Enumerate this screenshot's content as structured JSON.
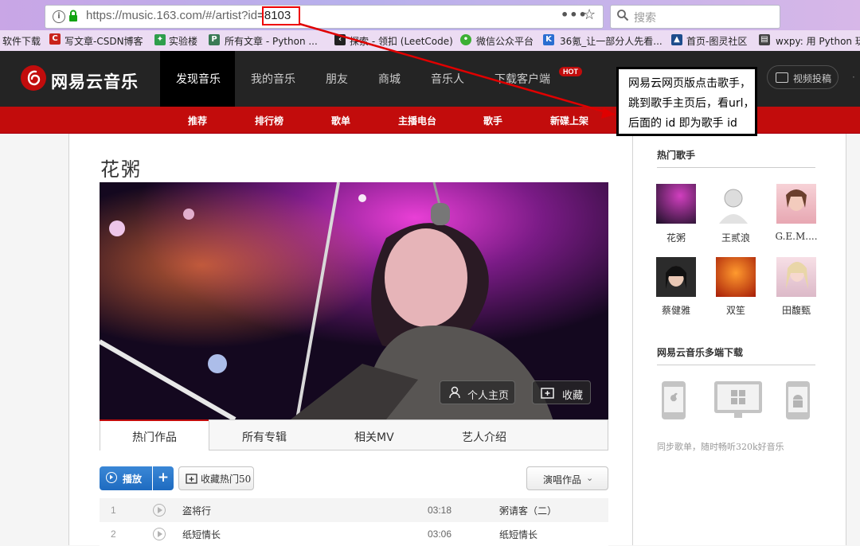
{
  "browser": {
    "url_prefix": "https://music.163.com/#/artist?id",
    "url_id": "=8103",
    "search_placeholder": "搜索",
    "more_label": "•••",
    "bookmarks": [
      {
        "label": "软件下载"
      },
      {
        "label": "写文章-CSDN博客"
      },
      {
        "label": "实验楼"
      },
      {
        "label": "所有文章 - Python ..."
      },
      {
        "label": "探索 - 领扣 (LeetCode)"
      },
      {
        "label": "微信公众平台"
      },
      {
        "label": "36氪_让一部分人先看..."
      },
      {
        "label": "首页-图灵社区"
      },
      {
        "label": "wxpy: 用 Python 玩"
      }
    ]
  },
  "site": {
    "logo": "网易云音乐",
    "nav": [
      {
        "label": "发现音乐",
        "active": true
      },
      {
        "label": "我的音乐"
      },
      {
        "label": "朋友"
      },
      {
        "label": "商城"
      },
      {
        "label": "音乐人"
      },
      {
        "label": "下载客户端"
      }
    ],
    "hot_badge": "HOT",
    "upload_label": "视频投稿",
    "subnav": [
      "推荐",
      "排行榜",
      "歌单",
      "主播电台",
      "歌手",
      "新碟上架"
    ]
  },
  "artist": {
    "name": "花粥",
    "photo_buttons": {
      "home": "个人主页",
      "collect": "收藏"
    }
  },
  "tabs": [
    {
      "label": "热门作品",
      "active": true
    },
    {
      "label": "所有专辑"
    },
    {
      "label": "相关MV"
    },
    {
      "label": "艺人介绍"
    }
  ],
  "toolbar": {
    "play_label": "播放",
    "add_label": "+",
    "collect_hot_label": "收藏热门50",
    "works_label": "演唱作品"
  },
  "songs": [
    {
      "index": "1",
      "title": "盗将行",
      "duration": "03:18",
      "album": "粥请客（二）"
    },
    {
      "index": "2",
      "title": "纸短情长",
      "duration": "03:06",
      "album": "纸短情长"
    }
  ],
  "sidebar": {
    "hot_artists_title": "热门歌手",
    "artists": [
      {
        "name": "花粥"
      },
      {
        "name": "王贰浪"
      },
      {
        "name": "G.E.M...."
      },
      {
        "name": "蔡健雅"
      },
      {
        "name": "双笙"
      },
      {
        "name": "田馥甄"
      }
    ],
    "download_title": "网易云音乐多端下载",
    "download_text": "同步歌单，随时畅听320k好音乐"
  },
  "annotation": {
    "lines": [
      "网易云网页版点击歌手，",
      "跳到歌手主页后，看url，",
      "后面的 id 即为歌手 id"
    ],
    "color": "#e00000"
  },
  "colors": {
    "brand_red": "#c20c0c",
    "header_dark": "#242424",
    "play_blue": "#2b78c9"
  }
}
